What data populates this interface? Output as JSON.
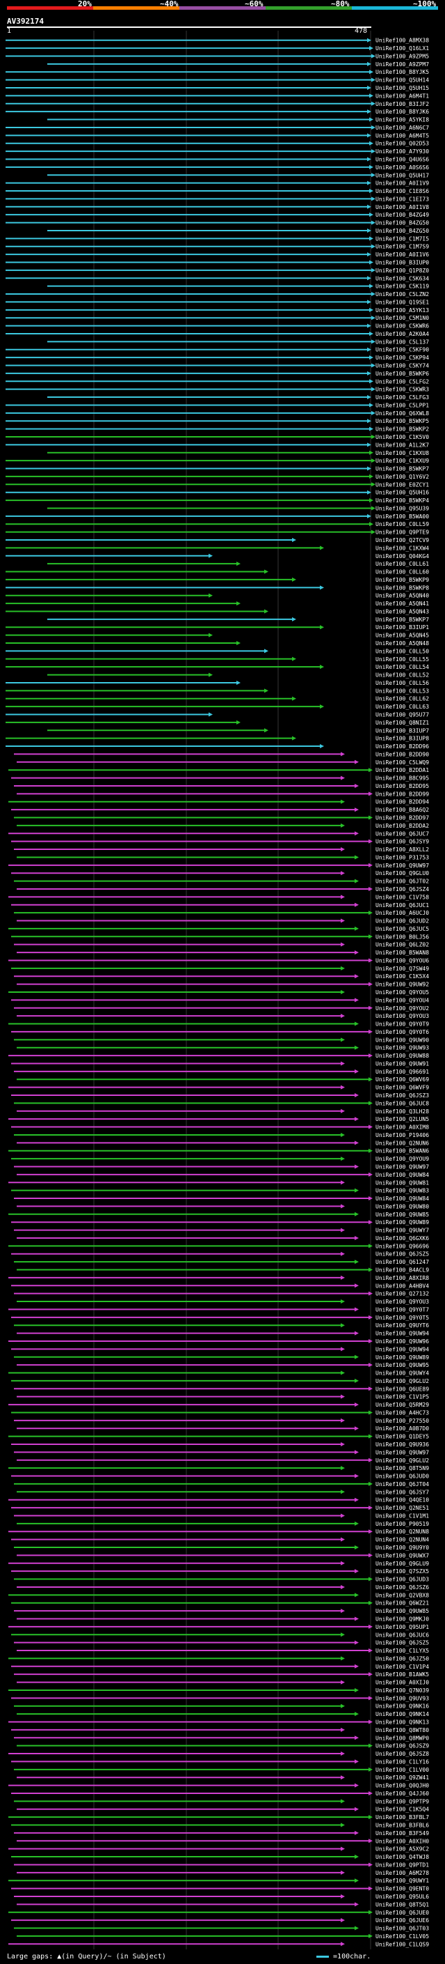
{
  "legend": {
    "labels": [
      "20%",
      "~40%",
      "~60%",
      "~80%",
      "~100%"
    ],
    "colors": [
      "#e31a1c",
      "#ff7f00",
      "#984ea3",
      "#33a02c",
      "#1ab7d8"
    ]
  },
  "query": {
    "name": "AV392174",
    "start": "1",
    "end": "478"
  },
  "colors": {
    "cyan": "#3cc8e0",
    "green": "#28c028",
    "magenta": "#d040d0"
  },
  "hits": [
    "UniRef100_A8MX38",
    "UniRef100_Q16LX1",
    "UniRef100_A9ZPM5",
    "UniRef100_A9ZPM7",
    "UniRef100_B8YJK5",
    "UniRef100_Q5UH14",
    "UniRef100_Q5UH15",
    "UniRef100_A6M4T1",
    "UniRef100_B3IJF2",
    "UniRef100_B8YJK6",
    "UniRef100_A5YKI8",
    "UniRef100_A6N6C7",
    "UniRef100_A6M4T5",
    "UniRef100_Q02D53",
    "UniRef100_A7Y930",
    "UniRef100_Q4U6S6",
    "UniRef100_A0S6S6",
    "UniRef100_Q5UH17",
    "UniRef100_A0I1V9",
    "UniRef100_C1E8S6",
    "UniRef100_C1EI73",
    "UniRef100_A0I1V8",
    "UniRef100_B4ZG49",
    "UniRef100_B4ZG50",
    "UniRef100_B4ZG50",
    "UniRef100_C1M7I5",
    "UniRef100_C1M7S9",
    "UniRef100_A0I1V6",
    "UniRef100_B3IUP0",
    "UniRef100_Q1P8Z0",
    "UniRef100_C5K634",
    "UniRef100_C5K119",
    "UniRef100_C5LZN2",
    "UniRef100_Q19SE1",
    "UniRef100_A5YK13",
    "UniRef100_C5M1N0",
    "UniRef100_C5KWR6",
    "UniRef100_A2K0A4",
    "UniRef100_C5L137",
    "UniRef100_C5KF90",
    "UniRef100_C5KP94",
    "UniRef100_C5KY74",
    "UniRef100_B5WKP6",
    "UniRef100_C5LFG2",
    "UniRef100_C5KWR3",
    "UniRef100_C5LFG3",
    "UniRef100_C5LPP1",
    "UniRef100_Q6XWL8",
    "UniRef100_B5WKP5",
    "UniRef100_B5WKP2",
    "UniRef100_C1K5V0",
    "UniRef100_A1L2K7",
    "UniRef100_C1KXU8",
    "UniRef100_C1KXU9",
    "UniRef100_B5WKP7",
    "UniRef100_Q1Y6V2",
    "UniRef100_E0ZCY1",
    "UniRef100_Q5UH16",
    "UniRef100_B5WKP4",
    "UniRef100_Q95U39",
    "UniRef100_B5WA00",
    "UniRef100_C0LL59",
    "UniRef100_Q9PTE9",
    "UniRef100_Q2TCV9",
    "UniRef100_C1KXW4",
    "UniRef100_Q04KG4",
    "UniRef100_C0LL61",
    "UniRef100_C0LL60",
    "UniRef100_B5WKP9",
    "UniRef100_B5WKP8",
    "UniRef100_A5QN40",
    "UniRef100_A5QN41",
    "UniRef100_A5QN43",
    "UniRef100_B5WKP7",
    "UniRef100_B3IUP1",
    "UniRef100_A5QN45",
    "UniRef100_A5QN48",
    "UniRef100_C0LL50",
    "UniRef100_C0LL55",
    "UniRef100_C0LL54",
    "UniRef100_C0LL52",
    "UniRef100_C0LL56",
    "UniRef100_C0LL53",
    "UniRef100_C0LL62",
    "UniRef100_C0LL63",
    "UniRef100_Q95U77",
    "UniRef100_Q8NIZ1",
    "UniRef100_B3IUP7",
    "UniRef100_B3IUP8",
    "UniRef100_B2DD96",
    "UniRef100_B2DD90",
    "UniRef100_C5LWQ9",
    "UniRef100_B2DDA1",
    "UniRef100_B8C995",
    "UniRef100_B2DD95",
    "UniRef100_B2DD99",
    "UniRef100_B2DD94",
    "UniRef100_B8A6Q2",
    "UniRef100_B2DD97",
    "UniRef100_B2DDA2",
    "UniRef100_Q6JUC7",
    "UniRef100_Q6JSY9",
    "UniRef100_A8XLL2",
    "UniRef100_P31753",
    "UniRef100_Q9UW97",
    "UniRef100_Q9GLU0",
    "UniRef100_Q6JT02",
    "UniRef100_Q6JSZ4",
    "UniRef100_C1V758",
    "UniRef100_Q6JUC1",
    "UniRef100_A6UCJ0",
    "UniRef100_Q6JUD2",
    "UniRef100_Q6JUC5",
    "UniRef100_B0LJ56",
    "UniRef100_Q6LZ02",
    "UniRef100_B5WAN8",
    "UniRef100_Q9YOU6",
    "UniRef100_Q7SW49",
    "UniRef100_C1K5X4",
    "UniRef100_Q9UW92",
    "UniRef100_Q9YOU5",
    "UniRef100_Q9YOU4",
    "UniRef100_Q9YOU2",
    "UniRef100_Q9YOU3",
    "UniRef100_Q9Y0T9",
    "UniRef100_Q9Y0T6",
    "UniRef100_Q9UW90",
    "UniRef100_Q9UW93",
    "UniRef100_Q9UW88",
    "UniRef100_Q9UW91",
    "UniRef100_Q96691",
    "UniRef100_Q6WV69",
    "UniRef100_Q6WVF9",
    "UniRef100_Q6JSZ3",
    "UniRef100_Q6JUC8",
    "UniRef100_Q3LH28",
    "UniRef100_Q2LUN5",
    "UniRef100_A0XIM8",
    "UniRef100_P19406",
    "UniRef100_Q2NUN6",
    "UniRef100_B5WAN6",
    "UniRef100_Q9YOU9",
    "UniRef100_Q9UW97",
    "UniRef100_Q9UW84",
    "UniRef100_Q9UW81",
    "UniRef100_Q9UW83",
    "UniRef100_Q9UW84",
    "UniRef100_Q9UW80",
    "UniRef100_Q9UW85",
    "UniRef100_Q9UW89",
    "UniRef100_Q9UWY7",
    "UniRef100_Q6GXK6",
    "UniRef100_Q96696",
    "UniRef100_Q6JSZ5",
    "UniRef100_Q61247",
    "UniRef100_B4ACL9",
    "UniRef100_A8XIR8",
    "UniRef100_A4HBV4",
    "UniRef100_Q27132",
    "UniRef100_Q9YOU3",
    "UniRef100_Q9Y0T7",
    "UniRef100_Q9Y0T5",
    "UniRef100_Q9UYT6",
    "UniRef100_Q9UW94",
    "UniRef100_Q9UW96",
    "UniRef100_Q9UW94",
    "UniRef100_Q9UW89",
    "UniRef100_Q9UW95",
    "UniRef100_Q9UWY4",
    "UniRef100_Q9GLU2",
    "UniRef100_Q6UE89",
    "UniRef100_C1V1P5",
    "UniRef100_Q5RM29",
    "UniRef100_A4HC73",
    "UniRef100_P27550",
    "UniRef100_A0B7D0",
    "UniRef100_Q1DEY5",
    "UniRef100_Q9U936",
    "UniRef100_Q9UW97",
    "UniRef100_Q9GLU2",
    "UniRef100_Q8T5N9",
    "UniRef100_Q6JUD0",
    "UniRef100_Q6JT04",
    "UniRef100_Q6JSY7",
    "UniRef100_Q4QE10",
    "UniRef100_Q2NE51",
    "UniRef100_C1V1M1",
    "UniRef100_P90519",
    "UniRef100_Q2NUN8",
    "UniRef100_Q2NUN4",
    "UniRef100_Q9U9Y0",
    "UniRef100_Q9UWX7",
    "UniRef100_Q9GLU9",
    "UniRef100_Q7SZX5",
    "UniRef100_Q6JUD3",
    "UniRef100_Q6JSZ6",
    "UniRef100_Q2VBX8",
    "UniRef100_Q6WZ21",
    "UniRef100_Q9UW85",
    "UniRef100_Q9MKJ0",
    "UniRef100_Q95UP1",
    "UniRef100_Q6JUC6",
    "UniRef100_Q6JSZ5",
    "UniRef100_C1LYX5",
    "UniRef100_Q6JZ50",
    "UniRef100_C1V1P4",
    "UniRef100_B1AWK5",
    "UniRef100_A0XIJ0",
    "UniRef100_Q7N039",
    "UniRef100_Q9UV93",
    "UniRef100_Q9NK16",
    "UniRef100_Q9NK14",
    "UniRef100_Q9NK13",
    "UniRef100_Q8WT80",
    "UniRef100_Q8MWP0",
    "UniRef100_Q6JSZ9",
    "UniRef100_Q6JSZ8",
    "UniRef100_C1LY16",
    "UniRef100_C1LV00",
    "UniRef100_Q9ZW41",
    "UniRef100_Q0QJH0",
    "UniRef100_Q4JJ60",
    "UniRef100_Q9PTP9",
    "UniRef100_C1K5Q4",
    "UniRef100_B3FBL7",
    "UniRef100_B3FBL6",
    "UniRef100_B3F549",
    "UniRef100_A0XIH0",
    "UniRef100_A5X9C2",
    "UniRef100_Q4TWJ8",
    "UniRef100_Q9PTD1",
    "UniRef100_A6M278",
    "UniRef100_Q9UWY1",
    "UniRef100_Q9ENT0",
    "UniRef100_Q95UL6",
    "UniRef100_Q8T5Q1",
    "UniRef100_Q6JUE0",
    "UniRef100_Q6JUE6",
    "UniRef100_Q6JT03",
    "UniRef100_C1LV05",
    "UniRef100_C1LQS9"
  ],
  "footer": {
    "left": "Large gaps: ▲(in Query)/~ (in Subject)",
    "right": "=100char."
  }
}
